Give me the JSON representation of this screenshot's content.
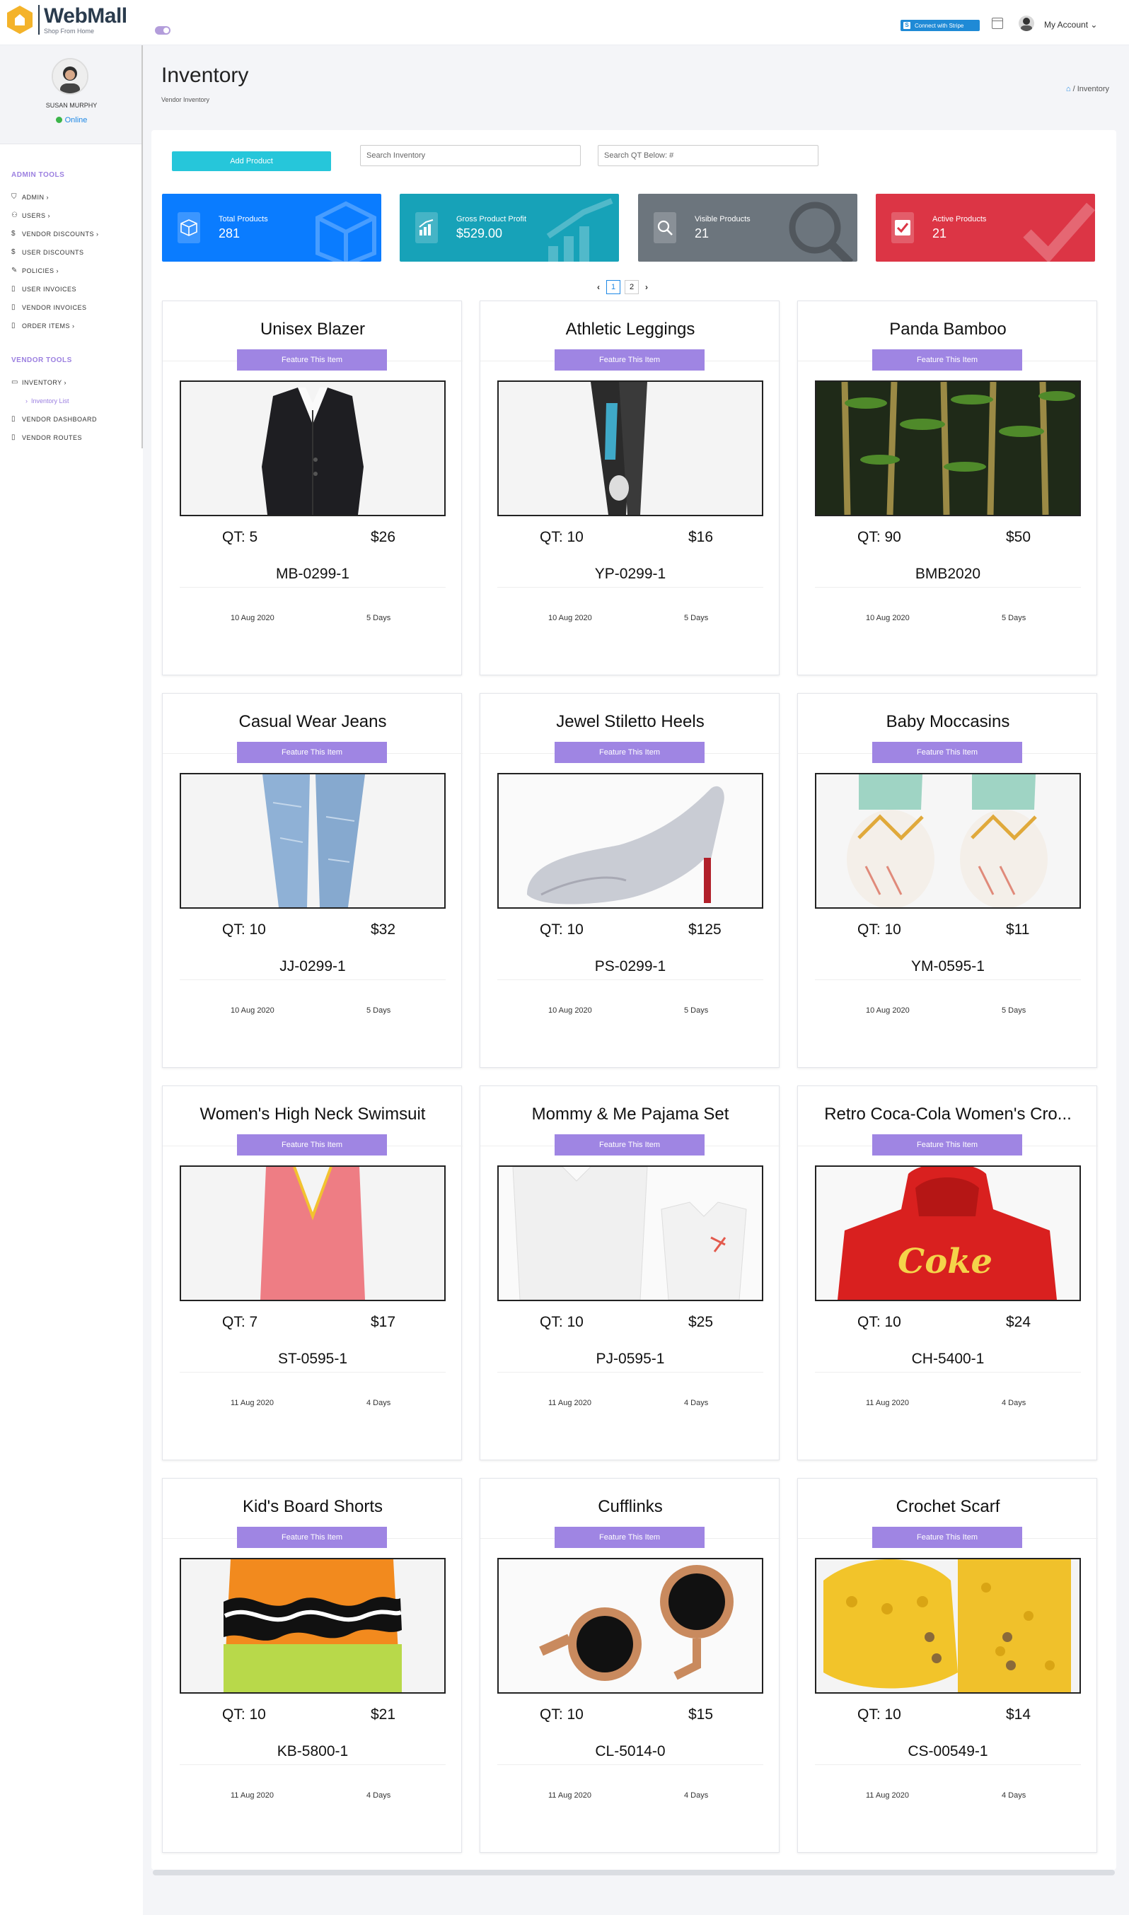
{
  "brand": {
    "title": "WebMall",
    "subtitle": "Shop From Home"
  },
  "topbar": {
    "stripe_label": "Connect with Stripe",
    "account_label": "My Account"
  },
  "sidebar": {
    "user_name": "SUSAN MURPHY",
    "status": "Online",
    "admin_section": "ADMIN TOOLS",
    "admin_items": [
      "ADMIN ›",
      "USERS ›",
      "VENDOR DISCOUNTS ›",
      "USER DISCOUNTS",
      "POLICIES ›",
      "USER INVOICES",
      "VENDOR INVOICES",
      "ORDER ITEMS ›"
    ],
    "vendor_section": "VENDOR TOOLS",
    "vendor_items": [
      "INVENTORY ›",
      "VENDOR DASHBOARD",
      "VENDOR ROUTES"
    ],
    "vendor_sub_item": "Inventory List"
  },
  "page": {
    "title": "Inventory",
    "subtitle": "Vendor Inventory",
    "breadcrumb": "Inventory"
  },
  "toolbar": {
    "add_label": "Add Product",
    "search_placeholder": "Search Inventory",
    "qt_placeholder": "Search QT Below: #"
  },
  "stats": [
    {
      "label": "Total Products",
      "value": "281",
      "color": "#0a7cff"
    },
    {
      "label": "Gross Product Profit",
      "value": "$529.00",
      "color": "#17a2b8"
    },
    {
      "label": "Visible Products",
      "value": "21",
      "color": "#6c757d"
    },
    {
      "label": "Active Products",
      "value": "21",
      "color": "#dc3545"
    }
  ],
  "pagination": {
    "pages": [
      "1",
      "2"
    ],
    "active": "1"
  },
  "feature_label": "Feature This Item",
  "products": [
    {
      "name": "Unisex Blazer",
      "qt": "QT: 5",
      "price": "$26",
      "sku": "MB-0299-1",
      "date": "10 Aug 2020",
      "age": "5 Days"
    },
    {
      "name": "Athletic Leggings",
      "qt": "QT: 10",
      "price": "$16",
      "sku": "YP-0299-1",
      "date": "10 Aug 2020",
      "age": "5 Days"
    },
    {
      "name": "Panda Bamboo",
      "qt": "QT: 90",
      "price": "$50",
      "sku": "BMB2020",
      "date": "10 Aug 2020",
      "age": "5 Days"
    },
    {
      "name": "Casual Wear Jeans",
      "qt": "QT: 10",
      "price": "$32",
      "sku": "JJ-0299-1",
      "date": "10 Aug 2020",
      "age": "5 Days"
    },
    {
      "name": "Jewel Stiletto Heels",
      "qt": "QT: 10",
      "price": "$125",
      "sku": "PS-0299-1",
      "date": "10 Aug 2020",
      "age": "5 Days"
    },
    {
      "name": "Baby Moccasins",
      "qt": "QT: 10",
      "price": "$11",
      "sku": "YM-0595-1",
      "date": "10 Aug 2020",
      "age": "5 Days"
    },
    {
      "name": "Women's High Neck Swimsuit",
      "qt": "QT: 7",
      "price": "$17",
      "sku": "ST-0595-1",
      "date": "11 Aug 2020",
      "age": "4 Days"
    },
    {
      "name": "Mommy & Me Pajama Set",
      "qt": "QT: 10",
      "price": "$25",
      "sku": "PJ-0595-1",
      "date": "11 Aug 2020",
      "age": "4 Days"
    },
    {
      "name": "Retro Coca-Cola Women's Cro...",
      "qt": "QT: 10",
      "price": "$24",
      "sku": "CH-5400-1",
      "date": "11 Aug 2020",
      "age": "4 Days"
    },
    {
      "name": "Kid's Board Shorts",
      "qt": "QT: 10",
      "price": "$21",
      "sku": "KB-5800-1",
      "date": "11 Aug 2020",
      "age": "4 Days"
    },
    {
      "name": "Cufflinks",
      "qt": "QT: 10",
      "price": "$15",
      "sku": "CL-5014-0",
      "date": "11 Aug 2020",
      "age": "4 Days"
    },
    {
      "name": "Crochet Scarf",
      "qt": "QT: 10",
      "price": "$14",
      "sku": "CS-00549-1",
      "date": "11 Aug 2020",
      "age": "4 Days"
    }
  ]
}
